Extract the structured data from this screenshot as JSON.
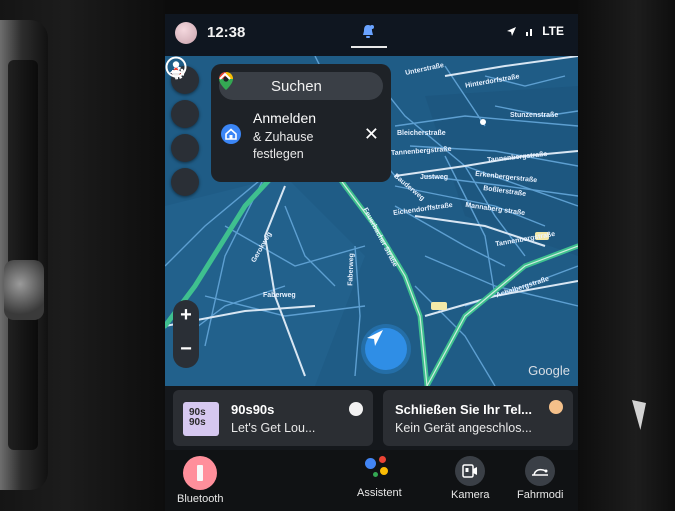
{
  "status": {
    "time": "12:38",
    "network": "LTE"
  },
  "map": {
    "search_label": "Suchen",
    "signin_title": "Anmelden",
    "signin_sub": "& Zuhause festlegen",
    "close_symbol": "✕",
    "google_label": "Google",
    "zoom_in": "+",
    "zoom_out": "−",
    "streets": {
      "s1": "Gerokweg",
      "s2": "Unterstraße",
      "s3": "Hinterdorfstraße",
      "s4": "Stunzenstraße",
      "s5": "Bleicherstraße",
      "s6": "Tannenbergstraße",
      "s7": "Tannenbergstraße",
      "s8": "Erkenbergerstraße",
      "s9": "Boßlerstraße",
      "s10": "Mannaberg straße",
      "s11": "Bauderweg",
      "s12": "Justweg",
      "s13": "Eichendorffstraße",
      "s14": "Faberweg",
      "s15": "Faberweg",
      "s16": "Achalbergstraße",
      "s17": "Feuerbacher Straße",
      "s18": "Tannenbergstraße"
    }
  },
  "cards": {
    "media_title": "90s90s",
    "media_sub": "Let's Get Lou...",
    "album_art": "90s 90s",
    "phone_title": "Schließen Sie Ihr Tel...",
    "phone_sub": "Kein Gerät angeschlos..."
  },
  "dock": {
    "bluetooth": "Bluetooth",
    "assistant": "Assistent",
    "camera": "Kamera",
    "drive": "Fahrmodi"
  },
  "colors": {
    "map_water": "#1f5c86",
    "road_green": "#3fc08f",
    "accent_blue": "#3b86f6",
    "bt_pink": "#ff8f9b"
  }
}
